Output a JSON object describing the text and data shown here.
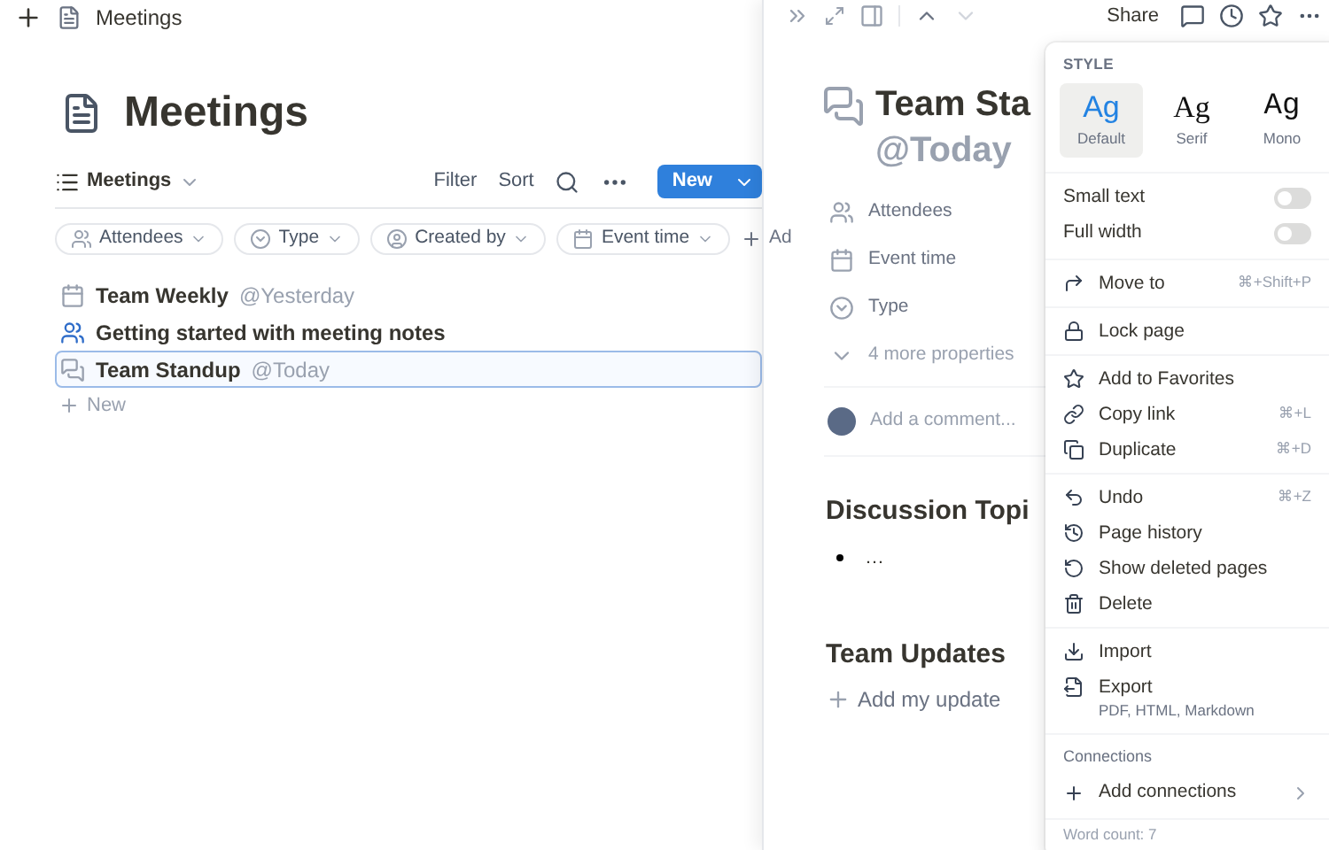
{
  "breadcrumb": {
    "title": "Meetings"
  },
  "page": {
    "title": "Meetings"
  },
  "view": {
    "label": "Meetings",
    "actions": [
      "Filter",
      "Sort"
    ],
    "new_button": "New"
  },
  "filters": [
    {
      "label": "Attendees"
    },
    {
      "label": "Type"
    },
    {
      "label": "Created by"
    },
    {
      "label": "Event time"
    }
  ],
  "add_filter": "Ad",
  "rows": [
    {
      "title": "Team Weekly",
      "mention": "@Yesterday",
      "selected": false
    },
    {
      "title": "Getting started with meeting notes",
      "mention": "",
      "selected": false
    },
    {
      "title": "Team Standup",
      "mention": "@Today",
      "selected": true
    }
  ],
  "new_row": "New",
  "peek": {
    "share": "Share",
    "title": "Team Sta",
    "title_mention": "@Today",
    "properties": [
      "Attendees",
      "Event time",
      "Type"
    ],
    "more_properties": "4 more properties",
    "comment_placeholder": "Add a comment...",
    "sections": [
      {
        "heading": "Discussion Topi",
        "bullets": [
          "…"
        ]
      },
      {
        "heading": "Team Updates",
        "add": "Add my update"
      }
    ]
  },
  "menu": {
    "style_label": "STYLE",
    "fonts": [
      {
        "sample": "Ag",
        "label": "Default",
        "selected": true
      },
      {
        "sample": "Ag",
        "label": "Serif",
        "selected": false
      },
      {
        "sample": "Ag",
        "label": "Mono",
        "selected": false
      }
    ],
    "toggles": [
      {
        "label": "Small text",
        "on": false
      },
      {
        "label": "Full width",
        "on": false
      }
    ],
    "groups": [
      [
        {
          "label": "Move to",
          "shortcut": "⌘+Shift+P"
        }
      ],
      [
        {
          "label": "Lock page"
        }
      ],
      [
        {
          "label": "Add to Favorites"
        },
        {
          "label": "Copy link",
          "shortcut": "⌘+L"
        },
        {
          "label": "Duplicate",
          "shortcut": "⌘+D"
        }
      ],
      [
        {
          "label": "Undo",
          "shortcut": "⌘+Z"
        },
        {
          "label": "Page history"
        },
        {
          "label": "Show deleted pages"
        },
        {
          "label": "Delete"
        }
      ],
      [
        {
          "label": "Import"
        },
        {
          "label": "Export",
          "sublabel": "PDF, HTML, Markdown"
        }
      ]
    ],
    "connections_label": "Connections",
    "add_connections": "Add connections",
    "word_count": "Word count: 7"
  }
}
